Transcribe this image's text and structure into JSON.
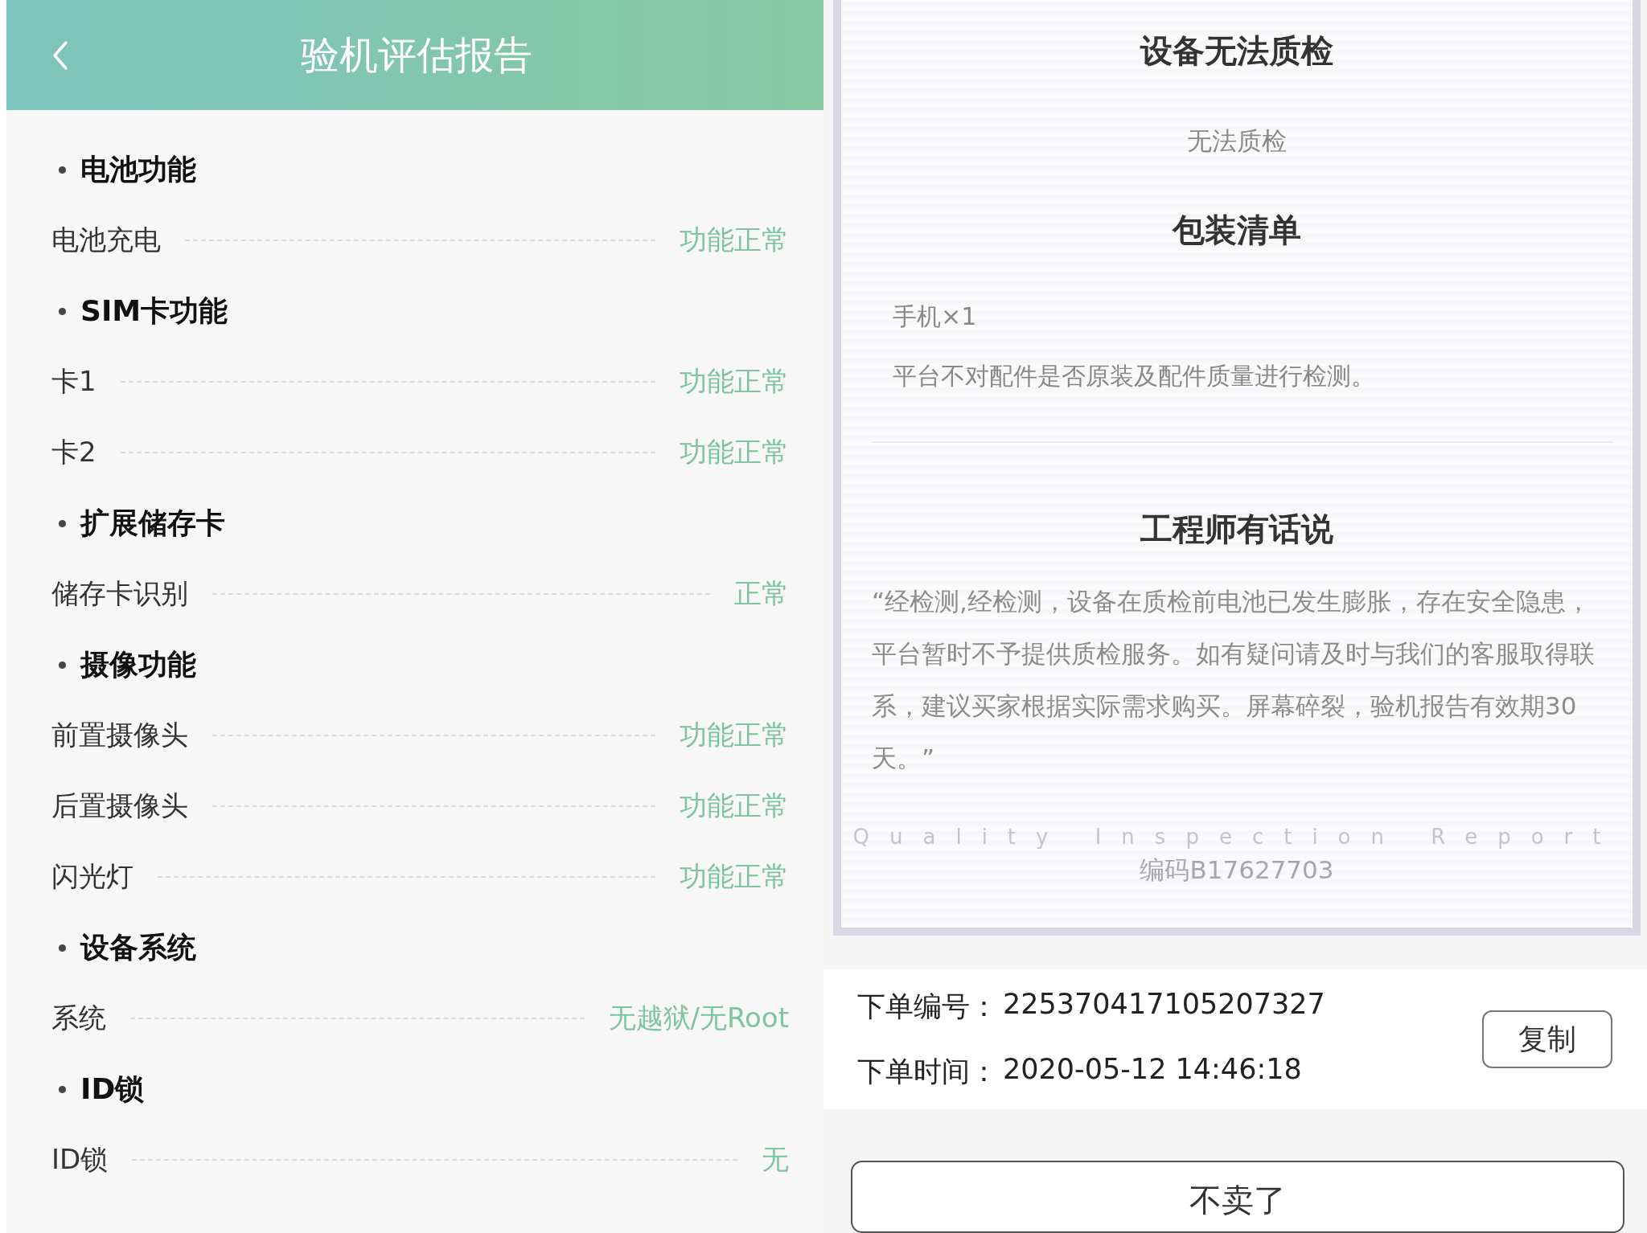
{
  "report": {
    "header": {
      "title": "验机评估报告"
    },
    "sections": [
      {
        "title": "电池功能",
        "items": [
          {
            "label": "电池充电",
            "value": "功能正常"
          }
        ]
      },
      {
        "title": "SIM卡功能",
        "items": [
          {
            "label": "卡1",
            "value": "功能正常"
          },
          {
            "label": "卡2",
            "value": "功能正常"
          }
        ]
      },
      {
        "title": "扩展储存卡",
        "items": [
          {
            "label": "储存卡识别",
            "value": "正常"
          }
        ]
      },
      {
        "title": "摄像功能",
        "items": [
          {
            "label": "前置摄像头",
            "value": "功能正常"
          },
          {
            "label": "后置摄像头",
            "value": "功能正常"
          },
          {
            "label": "闪光灯",
            "value": "功能正常"
          }
        ]
      },
      {
        "title": "设备系统",
        "items": [
          {
            "label": "系统",
            "value": "无越狱/无Root"
          }
        ]
      },
      {
        "title": "ID锁",
        "items": [
          {
            "label": "ID锁",
            "value": "无"
          }
        ]
      }
    ]
  },
  "certificate": {
    "title": "设备无法质检",
    "result": "无法质检",
    "packing_title": "包装清单",
    "packing_items": [
      "手机×1",
      "平台不对配件是否原装及配件质量进行检测。"
    ],
    "engineer_title": "工程师有话说",
    "engineer_note": "“经检测,经检测，设备在质检前电池已发生膨胀，存在安全隐患，平台暂时不予提供质检服务。如有疑问请及时与我们的客服取得联系，建议买家根据实际需求购买。屏幕碎裂，验机报告有效期30天。”",
    "watermark_text": "Quality Inspection Report",
    "code": "编码B17627703"
  },
  "order": {
    "fields": [
      {
        "label": "下单编号：",
        "value": "225370417105207327"
      },
      {
        "label": "下单时间：",
        "value": "2020-05-12 14:46:18"
      }
    ],
    "copy_button": "复制"
  },
  "bottom_button": "不卖了"
}
